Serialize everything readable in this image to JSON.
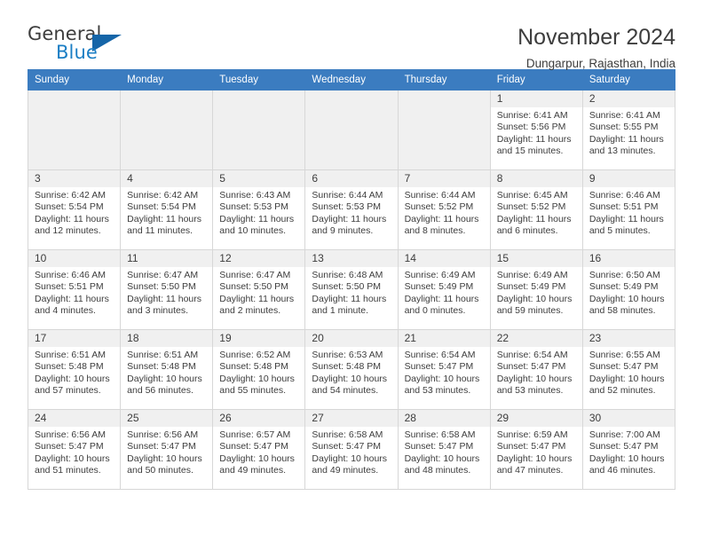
{
  "brand": {
    "name_top": "General",
    "name_bottom": "Blue",
    "triangle_color": "#1565a8",
    "blue_text_color": "#1b7ec4"
  },
  "header": {
    "title": "November 2024",
    "subtitle": "Dungarpur, Rajasthan, India"
  },
  "theme": {
    "header_blue": "#3b7cc0",
    "daynum_bg": "#f0f0f0",
    "grid_line": "#d7d7d7",
    "text": "#3d3d3d"
  },
  "weekdays": [
    "Sunday",
    "Monday",
    "Tuesday",
    "Wednesday",
    "Thursday",
    "Friday",
    "Saturday"
  ],
  "labels": {
    "sunrise_prefix": "Sunrise:",
    "sunset_prefix": "Sunset:",
    "daylight_prefix": "Daylight:"
  },
  "weeks": [
    [
      {
        "blank": true
      },
      {
        "blank": true
      },
      {
        "blank": true
      },
      {
        "blank": true
      },
      {
        "blank": true
      },
      {
        "day": "1",
        "sunrise": "Sunrise: 6:41 AM",
        "sunset": "Sunset: 5:56 PM",
        "daylight": "Daylight: 11 hours and 15 minutes."
      },
      {
        "day": "2",
        "sunrise": "Sunrise: 6:41 AM",
        "sunset": "Sunset: 5:55 PM",
        "daylight": "Daylight: 11 hours and 13 minutes."
      }
    ],
    [
      {
        "day": "3",
        "sunrise": "Sunrise: 6:42 AM",
        "sunset": "Sunset: 5:54 PM",
        "daylight": "Daylight: 11 hours and 12 minutes."
      },
      {
        "day": "4",
        "sunrise": "Sunrise: 6:42 AM",
        "sunset": "Sunset: 5:54 PM",
        "daylight": "Daylight: 11 hours and 11 minutes."
      },
      {
        "day": "5",
        "sunrise": "Sunrise: 6:43 AM",
        "sunset": "Sunset: 5:53 PM",
        "daylight": "Daylight: 11 hours and 10 minutes."
      },
      {
        "day": "6",
        "sunrise": "Sunrise: 6:44 AM",
        "sunset": "Sunset: 5:53 PM",
        "daylight": "Daylight: 11 hours and 9 minutes."
      },
      {
        "day": "7",
        "sunrise": "Sunrise: 6:44 AM",
        "sunset": "Sunset: 5:52 PM",
        "daylight": "Daylight: 11 hours and 8 minutes."
      },
      {
        "day": "8",
        "sunrise": "Sunrise: 6:45 AM",
        "sunset": "Sunset: 5:52 PM",
        "daylight": "Daylight: 11 hours and 6 minutes."
      },
      {
        "day": "9",
        "sunrise": "Sunrise: 6:46 AM",
        "sunset": "Sunset: 5:51 PM",
        "daylight": "Daylight: 11 hours and 5 minutes."
      }
    ],
    [
      {
        "day": "10",
        "sunrise": "Sunrise: 6:46 AM",
        "sunset": "Sunset: 5:51 PM",
        "daylight": "Daylight: 11 hours and 4 minutes."
      },
      {
        "day": "11",
        "sunrise": "Sunrise: 6:47 AM",
        "sunset": "Sunset: 5:50 PM",
        "daylight": "Daylight: 11 hours and 3 minutes."
      },
      {
        "day": "12",
        "sunrise": "Sunrise: 6:47 AM",
        "sunset": "Sunset: 5:50 PM",
        "daylight": "Daylight: 11 hours and 2 minutes."
      },
      {
        "day": "13",
        "sunrise": "Sunrise: 6:48 AM",
        "sunset": "Sunset: 5:50 PM",
        "daylight": "Daylight: 11 hours and 1 minute."
      },
      {
        "day": "14",
        "sunrise": "Sunrise: 6:49 AM",
        "sunset": "Sunset: 5:49 PM",
        "daylight": "Daylight: 11 hours and 0 minutes."
      },
      {
        "day": "15",
        "sunrise": "Sunrise: 6:49 AM",
        "sunset": "Sunset: 5:49 PM",
        "daylight": "Daylight: 10 hours and 59 minutes."
      },
      {
        "day": "16",
        "sunrise": "Sunrise: 6:50 AM",
        "sunset": "Sunset: 5:49 PM",
        "daylight": "Daylight: 10 hours and 58 minutes."
      }
    ],
    [
      {
        "day": "17",
        "sunrise": "Sunrise: 6:51 AM",
        "sunset": "Sunset: 5:48 PM",
        "daylight": "Daylight: 10 hours and 57 minutes."
      },
      {
        "day": "18",
        "sunrise": "Sunrise: 6:51 AM",
        "sunset": "Sunset: 5:48 PM",
        "daylight": "Daylight: 10 hours and 56 minutes."
      },
      {
        "day": "19",
        "sunrise": "Sunrise: 6:52 AM",
        "sunset": "Sunset: 5:48 PM",
        "daylight": "Daylight: 10 hours and 55 minutes."
      },
      {
        "day": "20",
        "sunrise": "Sunrise: 6:53 AM",
        "sunset": "Sunset: 5:48 PM",
        "daylight": "Daylight: 10 hours and 54 minutes."
      },
      {
        "day": "21",
        "sunrise": "Sunrise: 6:54 AM",
        "sunset": "Sunset: 5:47 PM",
        "daylight": "Daylight: 10 hours and 53 minutes."
      },
      {
        "day": "22",
        "sunrise": "Sunrise: 6:54 AM",
        "sunset": "Sunset: 5:47 PM",
        "daylight": "Daylight: 10 hours and 53 minutes."
      },
      {
        "day": "23",
        "sunrise": "Sunrise: 6:55 AM",
        "sunset": "Sunset: 5:47 PM",
        "daylight": "Daylight: 10 hours and 52 minutes."
      }
    ],
    [
      {
        "day": "24",
        "sunrise": "Sunrise: 6:56 AM",
        "sunset": "Sunset: 5:47 PM",
        "daylight": "Daylight: 10 hours and 51 minutes."
      },
      {
        "day": "25",
        "sunrise": "Sunrise: 6:56 AM",
        "sunset": "Sunset: 5:47 PM",
        "daylight": "Daylight: 10 hours and 50 minutes."
      },
      {
        "day": "26",
        "sunrise": "Sunrise: 6:57 AM",
        "sunset": "Sunset: 5:47 PM",
        "daylight": "Daylight: 10 hours and 49 minutes."
      },
      {
        "day": "27",
        "sunrise": "Sunrise: 6:58 AM",
        "sunset": "Sunset: 5:47 PM",
        "daylight": "Daylight: 10 hours and 49 minutes."
      },
      {
        "day": "28",
        "sunrise": "Sunrise: 6:58 AM",
        "sunset": "Sunset: 5:47 PM",
        "daylight": "Daylight: 10 hours and 48 minutes."
      },
      {
        "day": "29",
        "sunrise": "Sunrise: 6:59 AM",
        "sunset": "Sunset: 5:47 PM",
        "daylight": "Daylight: 10 hours and 47 minutes."
      },
      {
        "day": "30",
        "sunrise": "Sunrise: 7:00 AM",
        "sunset": "Sunset: 5:47 PM",
        "daylight": "Daylight: 10 hours and 46 minutes."
      }
    ]
  ]
}
